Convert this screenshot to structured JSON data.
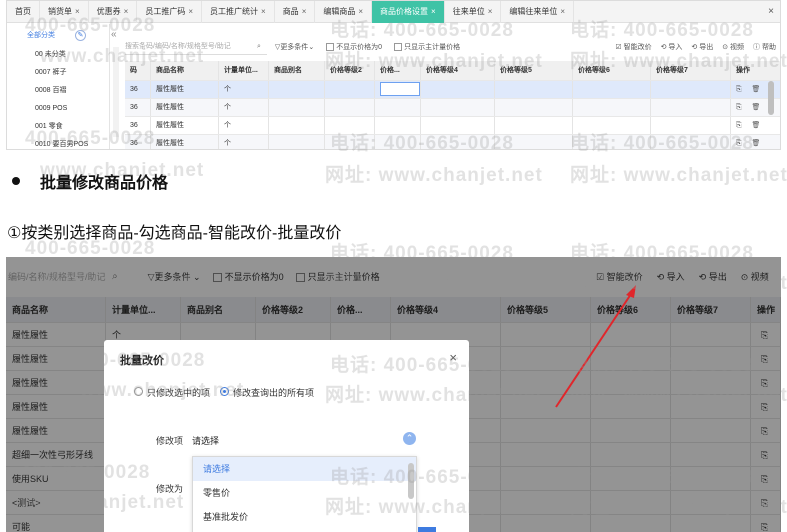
{
  "shot1": {
    "tabs": [
      {
        "label": "首页",
        "closable": false,
        "active": false
      },
      {
        "label": "销货单",
        "closable": true,
        "active": false
      },
      {
        "label": "优惠券",
        "closable": true,
        "active": false
      },
      {
        "label": "员工推广码",
        "closable": true,
        "active": false
      },
      {
        "label": "员工推广统计",
        "closable": true,
        "active": false
      },
      {
        "label": "商品",
        "closable": true,
        "active": false
      },
      {
        "label": "编辑商品",
        "closable": true,
        "active": false
      },
      {
        "label": "商品价格设置",
        "closable": true,
        "active": true
      },
      {
        "label": "往来单位",
        "closable": true,
        "active": false
      },
      {
        "label": "编辑往来单位",
        "closable": true,
        "active": false
      }
    ],
    "close_x": "×",
    "tree": {
      "all_label": "全部分类",
      "items": [
        "00 未分类",
        "0007 裤子",
        "0008 百褶",
        "0009 POS",
        "001 零食",
        "0010 要百男POS"
      ]
    },
    "collapse_glyph": "«",
    "toolbar": {
      "search_placeholder": "搜索条码/编码/名称/规格型号/助记",
      "more": "更多条件",
      "opt_zero": "不显示价格为0",
      "opt_main_unit": "只显示主计量价格",
      "smart": "智能改价",
      "import": "导入",
      "export": "导出",
      "view": "视频",
      "help": "帮助"
    },
    "columns": [
      "码",
      "商品名称",
      "计量单位...",
      "商品别名",
      "价格等级2",
      "价格...",
      "价格等级4",
      "价格等级5",
      "价格等级6",
      "价格等级7",
      "操作"
    ],
    "rows": [
      [
        "36",
        "履性履性",
        "个",
        "",
        "",
        "",
        "",
        "",
        "",
        ""
      ],
      [
        "36",
        "履性履性",
        "个",
        "",
        "",
        "",
        "",
        "",
        "",
        ""
      ],
      [
        "36",
        "履性履性",
        "个",
        "",
        "",
        "",
        "",
        "",
        "",
        ""
      ],
      [
        "36",
        "履性履性",
        "个",
        "",
        "",
        "",
        "",
        "",
        "",
        ""
      ]
    ],
    "op_icons": "⎘ 🗑"
  },
  "text": {
    "bullet_title": "批量修改商品价格",
    "step": "①按类别选择商品-勾选商品-智能改价-批量改价"
  },
  "shot2": {
    "toolbar": {
      "search_placeholder": "编码/名称/规格型号/助记",
      "more": "更多条件",
      "opt_zero": "不显示价格为0",
      "opt_main_unit": "只显示主计量价格",
      "smart": "智能改价",
      "import": "导入",
      "export": "导出",
      "view": "视频"
    },
    "columns": [
      "商品名称",
      "计量单位...",
      "商品别名",
      "价格等级2",
      "价格...",
      "价格等级4",
      "价格等级5",
      "价格等级6",
      "价格等级7",
      "操作"
    ],
    "rows": [
      [
        "履性履性",
        "个"
      ],
      [
        "履性履性",
        ""
      ],
      [
        "履性履性",
        ""
      ],
      [
        "履性履性",
        ""
      ],
      [
        "履性履性",
        ""
      ],
      [
        "超细一次性弓形牙线",
        ""
      ],
      [
        "使用SKU",
        ""
      ],
      [
        "<测试>",
        ""
      ],
      [
        "可能",
        ""
      ]
    ],
    "modal": {
      "title": "批量改价",
      "close": "×",
      "radio_selected_items": "只修改选中的项",
      "radio_all_items": "修改查询出的所有项",
      "field_label": "修改项",
      "field_value": "请选择",
      "change_label": "修改为",
      "options": [
        "请选择",
        "零售价",
        "基准批发价"
      ]
    }
  },
  "watermark": {
    "phone": "电话: 400-665-0028",
    "phone_left": "400-665-0028",
    "site": "网址: www.chanjet.net",
    "site_left": "www.chanjet.net"
  },
  "colors": {
    "active_tab": "#3fc3a6",
    "accent_blue": "#3e7be0",
    "arrow_red": "#e0262b"
  }
}
